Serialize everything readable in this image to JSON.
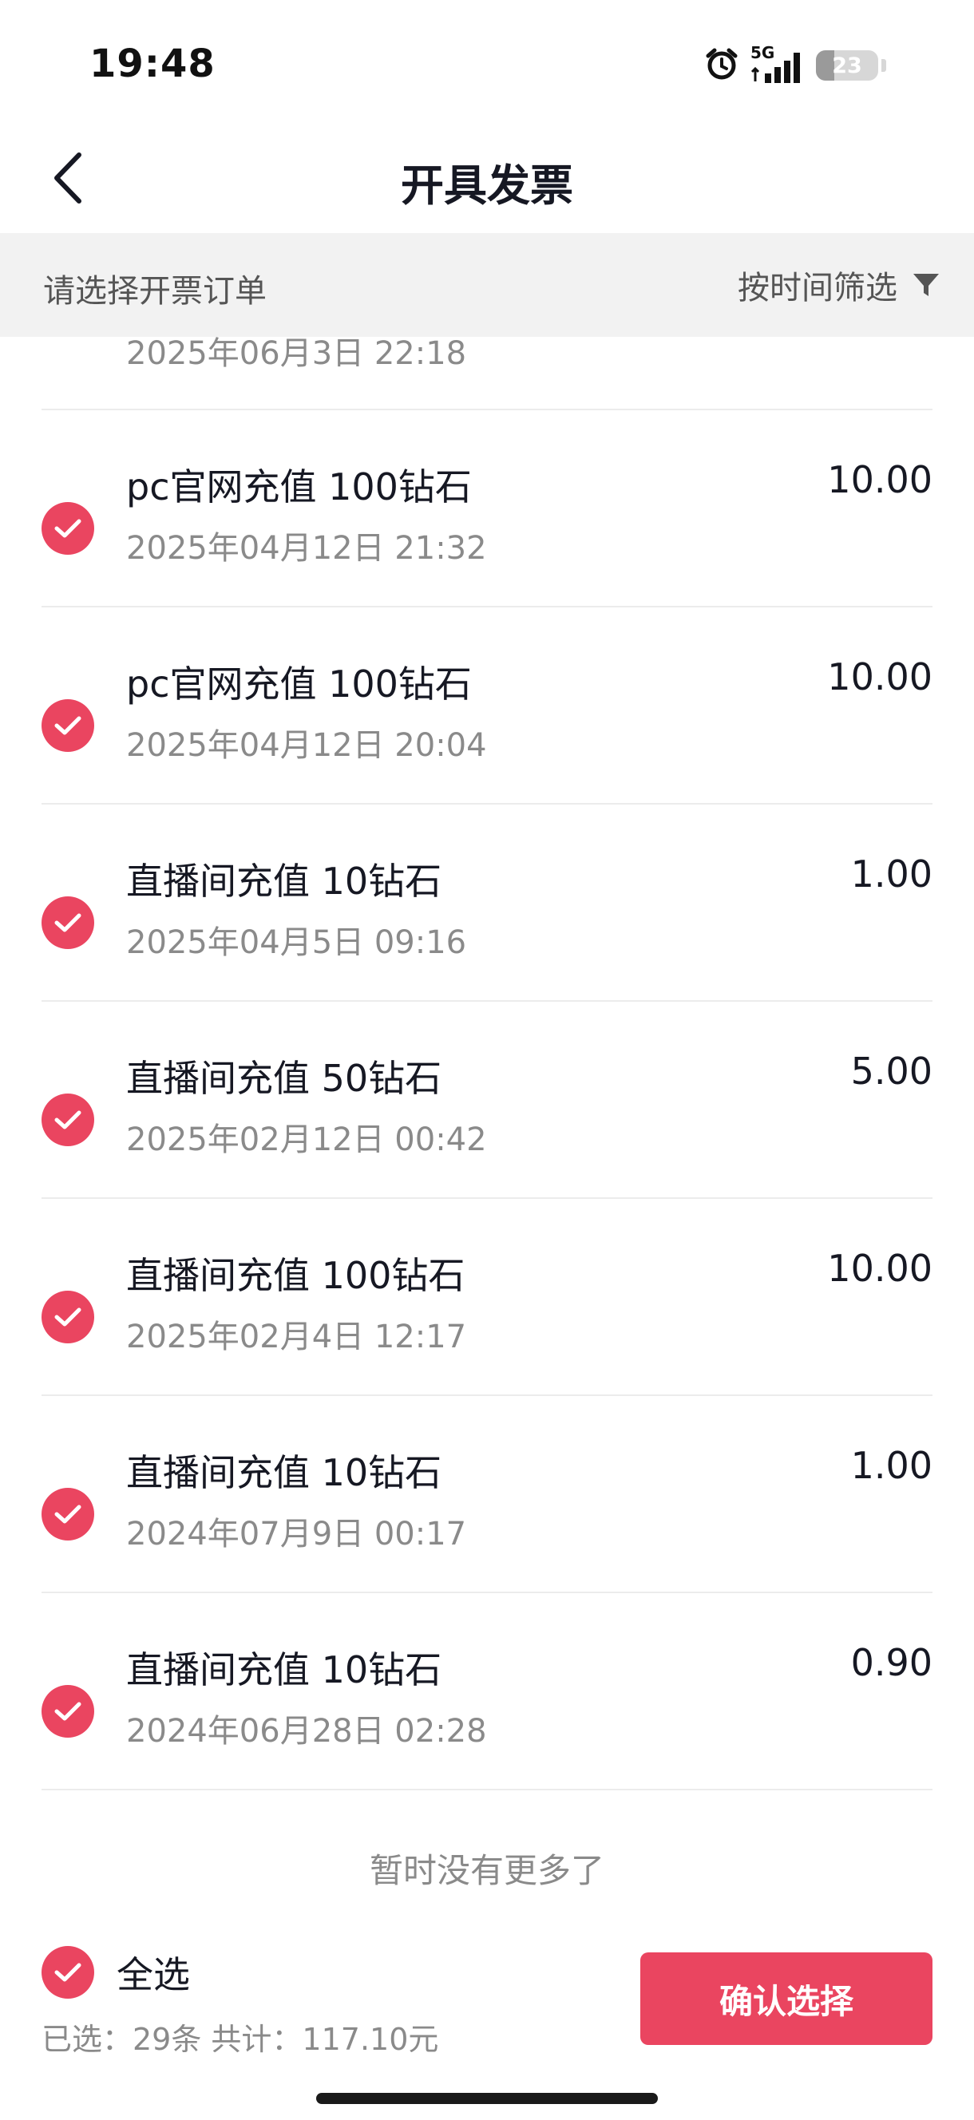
{
  "status": {
    "time": "19:48",
    "network": "5G",
    "battery": "23"
  },
  "header": {
    "title": "开具发票"
  },
  "filter": {
    "hint": "请选择开票订单",
    "label": "按时间筛选"
  },
  "orders": [
    {
      "title": "",
      "date": "2025年06月3日 22:18",
      "amount": ""
    },
    {
      "title": "pc官网充值 100钻石",
      "date": "2025年04月12日 21:32",
      "amount": "10.00"
    },
    {
      "title": "pc官网充值 100钻石",
      "date": "2025年04月12日 20:04",
      "amount": "10.00"
    },
    {
      "title": "直播间充值 10钻石",
      "date": "2025年04月5日 09:16",
      "amount": "1.00"
    },
    {
      "title": "直播间充值 50钻石",
      "date": "2025年02月12日 00:42",
      "amount": "5.00"
    },
    {
      "title": "直播间充值 100钻石",
      "date": "2025年02月4日 12:17",
      "amount": "10.00"
    },
    {
      "title": "直播间充值 10钻石",
      "date": "2024年07月9日 00:17",
      "amount": "1.00"
    },
    {
      "title": "直播间充值 10钻石",
      "date": "2024年06月28日 02:28",
      "amount": "0.90"
    }
  ],
  "list_footer": "暂时没有更多了",
  "bottom": {
    "select_all": "全选",
    "summary": "已选：29条 共计：117.10元",
    "confirm": "确认选择"
  },
  "colors": {
    "accent": "#ea4560",
    "filter_bg": "#f2f2f2"
  }
}
